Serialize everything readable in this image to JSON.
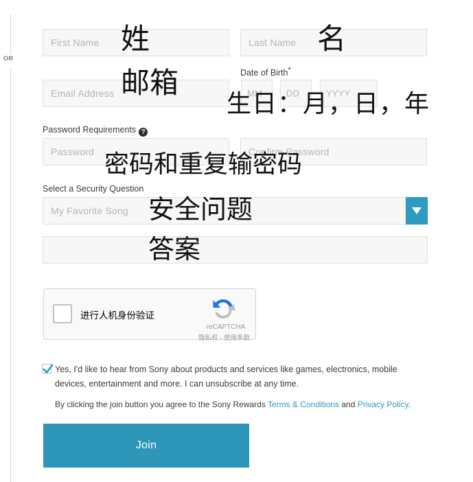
{
  "divider": {
    "or_label": "OR"
  },
  "form": {
    "first_name": {
      "placeholder": "First Name",
      "value": ""
    },
    "last_name": {
      "placeholder": "Last Name",
      "value": ""
    },
    "email": {
      "placeholder": "Email Address",
      "value": ""
    },
    "date_of_birth": {
      "label": "Date of Birth",
      "required_mark": "*",
      "month": {
        "placeholder": "MM",
        "value": ""
      },
      "day": {
        "placeholder": "DD",
        "value": ""
      },
      "year": {
        "placeholder": "YYYY",
        "value": ""
      }
    },
    "password": {
      "label": "Password Requirements",
      "help_icon": "question-mark-help-icon",
      "placeholder": "Password",
      "value": ""
    },
    "confirm_password": {
      "placeholder": "Confirm Password",
      "value": ""
    },
    "security_question": {
      "label": "Select a Security Question",
      "selected": "My Favorite Song",
      "arrow_icon": "chevron-down-icon"
    },
    "security_answer": {
      "placeholder": "",
      "value": ""
    }
  },
  "recaptcha": {
    "label": "进行人机身份验证",
    "brand": "reCAPTCHA",
    "legal": "隐私权 - 使用条款",
    "logo_icon": "recaptcha-refresh-logo-icon",
    "checked": false
  },
  "consent": {
    "checked": true,
    "text": "Yes, I'd like to hear from Sony about products and services like games, electronics, mobile devices, entertainment and more. I can unsubscribe at any time.",
    "terms_prefix": "By clicking the join button you agree to the Sony Rewards ",
    "terms_link": "Terms & Conditions",
    "terms_middle": " and ",
    "privacy_link": "Privacy Policy",
    "terms_suffix": "."
  },
  "actions": {
    "join_label": "Join"
  },
  "annotations": [
    {
      "text": "姓",
      "id": "anno-first-name"
    },
    {
      "text": "名",
      "id": "anno-last-name"
    },
    {
      "text": "邮箱",
      "id": "anno-email"
    },
    {
      "text": "生日：月，日，年",
      "id": "anno-dob"
    },
    {
      "text": "密码和重复输密码",
      "id": "anno-password"
    },
    {
      "text": "安全问题",
      "id": "anno-security-question"
    },
    {
      "text": "答案",
      "id": "anno-security-answer"
    }
  ],
  "colors": {
    "accent": "#2e9ac0",
    "button": "#2e96b8",
    "field_bg": "#f7f7f7",
    "field_border": "#e0e0e0",
    "link": "#2e9ac0"
  }
}
